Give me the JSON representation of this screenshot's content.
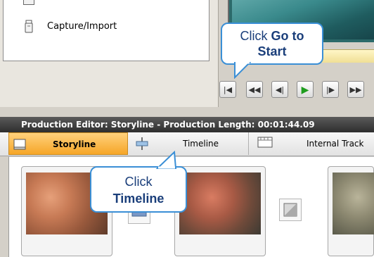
{
  "task_panel": {
    "capture_label": "Capture/Import"
  },
  "playback": {
    "go_to_start": "|◀",
    "rewind": "◀◀",
    "step_back": "◀|",
    "play": "▶",
    "step_forward": "|▶",
    "fast_forward": "▶▶"
  },
  "callout_go_to_start": {
    "line1_plain": "Click ",
    "line1_strong": "Go to",
    "line2_strong": "Start"
  },
  "callout_timeline": {
    "line1_plain": "Click",
    "line2_strong": "Timeline"
  },
  "editor": {
    "title": "Production Editor: Storyline - Production Length: 00:01:44.09"
  },
  "tabs": {
    "storyline": "Storyline",
    "timeline": "Timeline",
    "internal": "Internal Track"
  },
  "colors": {
    "callout_border": "#3a8fd6",
    "callout_text": "#1a3e7a",
    "storyline_tab": "#f6a628",
    "title_bar": "#3a3a3a"
  }
}
